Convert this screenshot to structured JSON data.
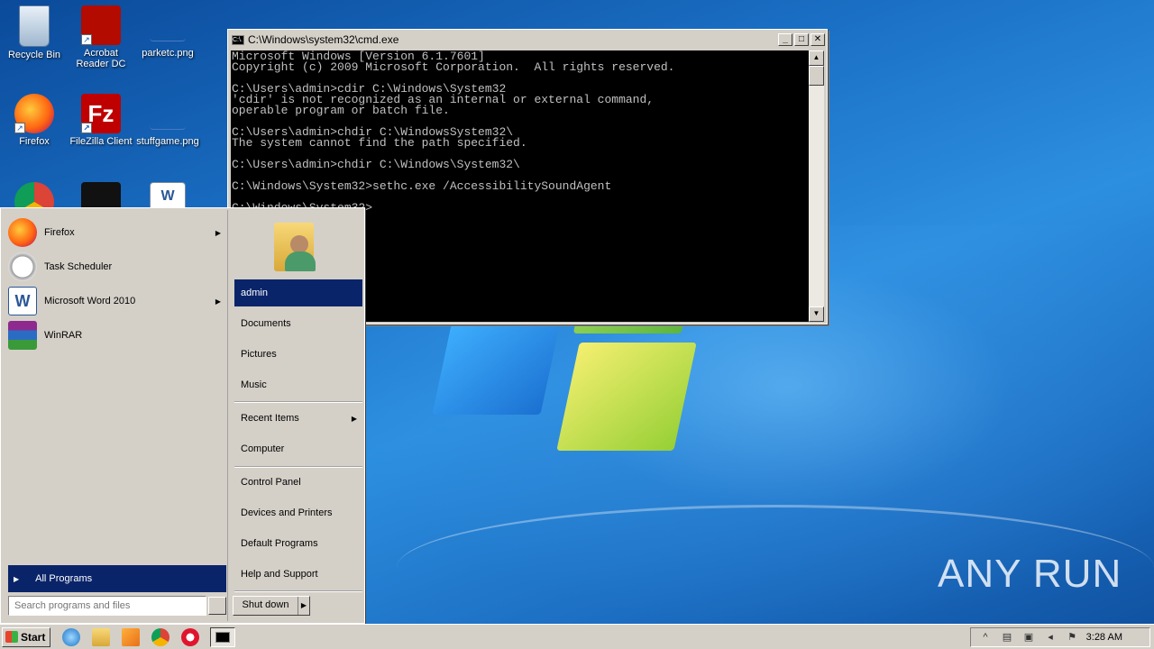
{
  "desktop": {
    "icons": [
      {
        "label": "Recycle Bin",
        "icon": "recycle-bin-icon"
      },
      {
        "label": "Acrobat Reader DC",
        "icon": "acrobat-icon"
      },
      {
        "label": "parketc.png",
        "icon": "image-file-icon"
      },
      {
        "label": "Firefox",
        "icon": "firefox-icon"
      },
      {
        "label": "FileZilla Client",
        "icon": "filezilla-icon"
      },
      {
        "label": "stuffgame.png",
        "icon": "image-file-icon"
      }
    ],
    "watermark": "ANY RUN"
  },
  "cmd": {
    "title": "C:\\Windows\\system32\\cmd.exe",
    "icon_text": "C:\\.",
    "lines": [
      "Microsoft Windows [Version 6.1.7601]",
      "Copyright (c) 2009 Microsoft Corporation.  All rights reserved.",
      "",
      "C:\\Users\\admin>cdir C:\\Windows\\System32",
      "'cdir' is not recognized as an internal or external command,",
      "operable program or batch file.",
      "",
      "C:\\Users\\admin>chdir C:\\WindowsSystem32\\",
      "The system cannot find the path specified.",
      "",
      "C:\\Users\\admin>chdir C:\\Windows\\System32\\",
      "",
      "C:\\Windows\\System32>sethc.exe /AccessibilitySoundAgent",
      "",
      "C:\\Windows\\System32>"
    ],
    "buttons": {
      "minimize": "_",
      "maximize": "□",
      "close": "✕"
    }
  },
  "start_menu": {
    "programs": [
      {
        "label": "Firefox",
        "has_submenu": true
      },
      {
        "label": "Task Scheduler",
        "has_submenu": false
      },
      {
        "label": "Microsoft Word 2010",
        "has_submenu": true
      },
      {
        "label": "WinRAR",
        "has_submenu": false
      }
    ],
    "all_programs": "All Programs",
    "search_placeholder": "Search programs and files",
    "user": "admin",
    "links": [
      {
        "label": "Documents"
      },
      {
        "label": "Pictures"
      },
      {
        "label": "Music"
      },
      {
        "label": "Recent Items",
        "has_submenu": true
      },
      {
        "label": "Computer"
      },
      {
        "label": "Control Panel"
      },
      {
        "label": "Devices and Printers"
      },
      {
        "label": "Default Programs"
      },
      {
        "label": "Help and Support"
      }
    ],
    "shutdown": "Shut down"
  },
  "taskbar": {
    "start": "Start",
    "clock": "3:28 AM"
  },
  "colors": {
    "menu_highlight": "#0a246a",
    "classic_gray": "#d4d0c8"
  }
}
